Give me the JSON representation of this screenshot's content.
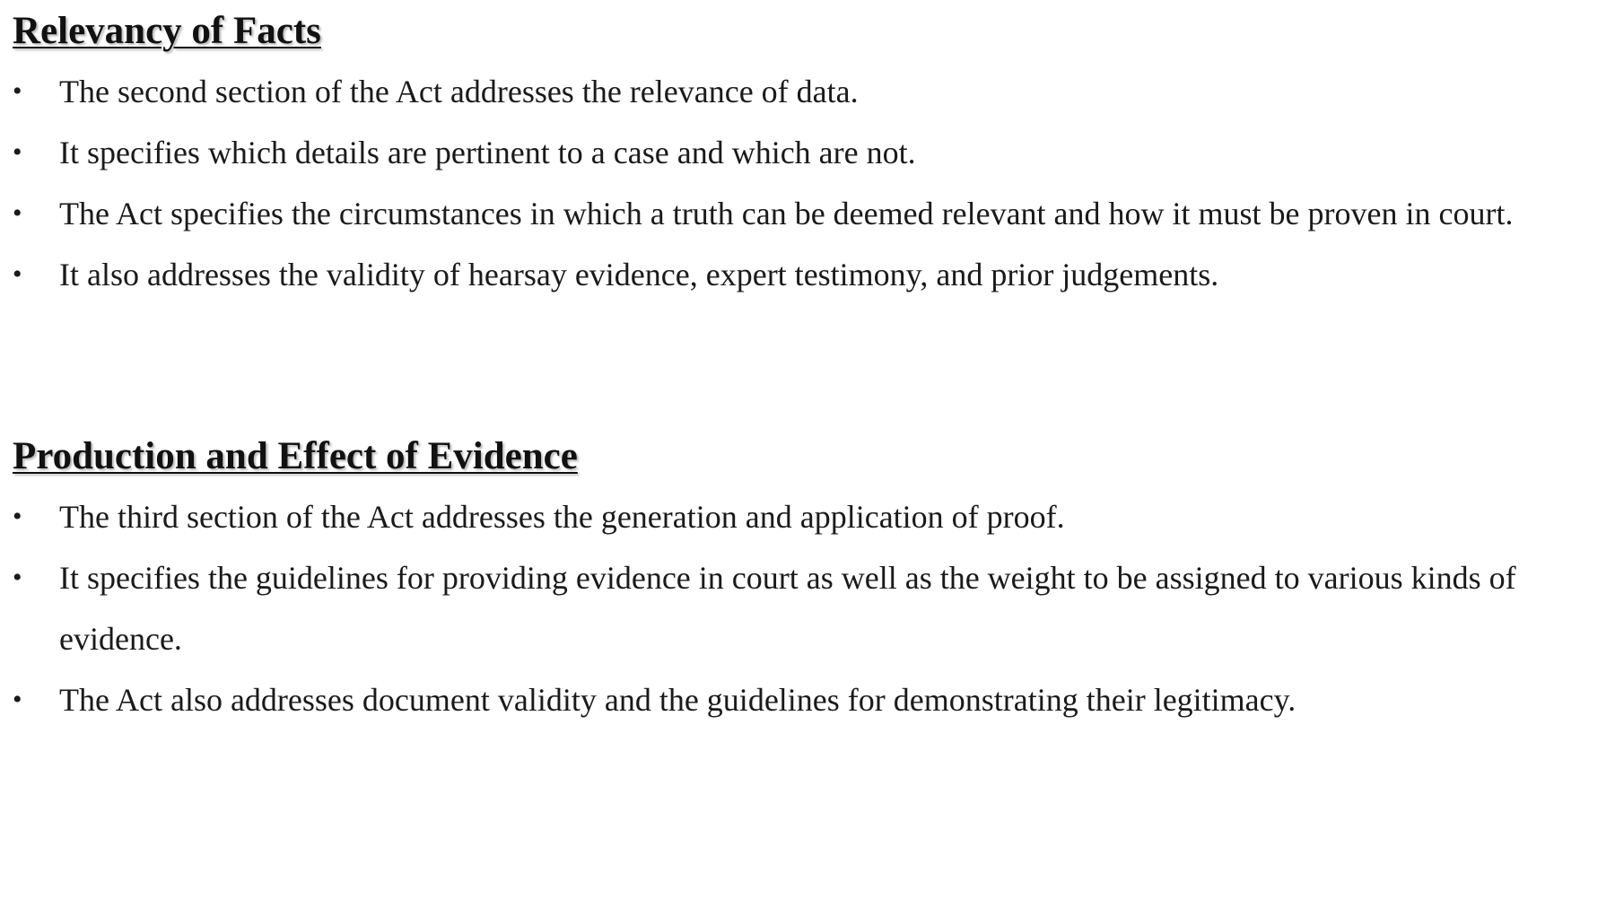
{
  "sections": [
    {
      "heading": "Relevancy of Facts",
      "bullets": [
        "The second section of the Act addresses the relevance of data.",
        "It specifies which details are pertinent to a case and which are not.",
        "The Act specifies the circumstances in which a truth can be deemed relevant and how it must be proven in court.",
        "It also addresses the validity of hearsay evidence, expert testimony, and prior judgements."
      ]
    },
    {
      "heading": "Production and Effect of Evidence",
      "bullets": [
        "The third section of the Act addresses the generation and application of proof.",
        "It specifies the guidelines for providing evidence in court as well as the weight to be assigned to various kinds of evidence.",
        "The Act also addresses document validity and the guidelines for demonstrating their legitimacy."
      ]
    }
  ],
  "bullet_glyph": "•"
}
